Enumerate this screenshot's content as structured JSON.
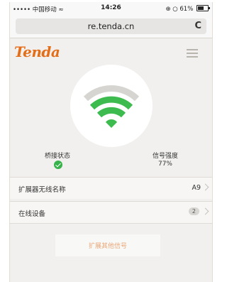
{
  "status_bar": {
    "carrier": "••••• 中国移动",
    "time": "14:26",
    "battery": "61%"
  },
  "browser": {
    "url": "re.tenda.cn",
    "reload_glyph": "C"
  },
  "header": {
    "logo": "Tenda"
  },
  "signal": {
    "bridge_status_label": "桥接状态",
    "strength_label": "信号强度",
    "strength_value": "77%",
    "colors": {
      "active": "#3dbb4f",
      "inactive": "#d7d5d1",
      "check": "#38b24a"
    }
  },
  "list": {
    "wifi_name_label": "扩展器无线名称",
    "wifi_name_value": "A9",
    "online_devices_label": "在线设备",
    "online_devices_count": "2"
  },
  "actions": {
    "extend_other_label": "扩展其他信号"
  },
  "colors": {
    "brand": "#e46d17"
  }
}
